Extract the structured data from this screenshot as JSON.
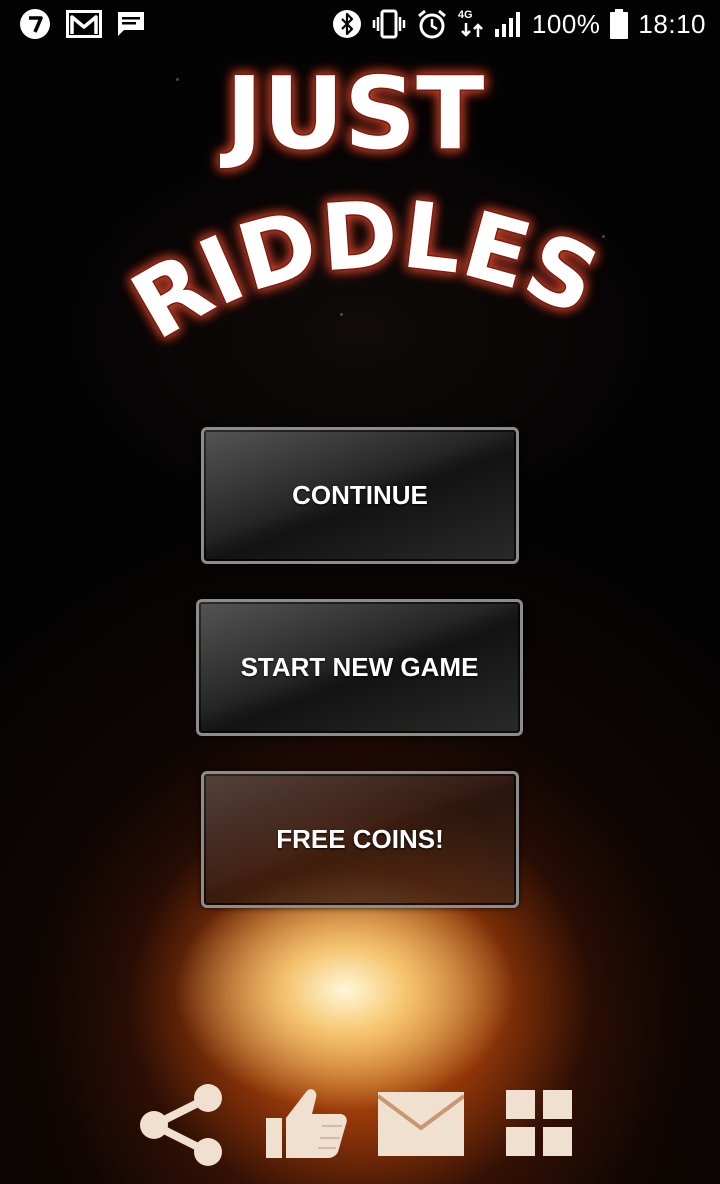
{
  "status_bar": {
    "battery_percent": "100%",
    "time": "18:10",
    "network_label": "4G",
    "left_icons": [
      "app-notification-icon",
      "gmail-icon",
      "message-icon"
    ],
    "right_icons": [
      "bluetooth-icon",
      "vibrate-icon",
      "alarm-icon",
      "signal-icon",
      "battery-icon"
    ]
  },
  "title": {
    "line1": "JUST",
    "line2": "RIDDLES"
  },
  "menu": {
    "continue_label": "CONTINUE",
    "start_new_game_label": "START NEW GAME",
    "free_coins_label": "FREE COINS!"
  },
  "bottom_actions": [
    "share-icon",
    "thumbs-up-icon",
    "mail-icon",
    "more-apps-grid-icon"
  ],
  "colors": {
    "title_fill": "#ffffff",
    "title_outline": "#7a1a0c",
    "button_border": "#8c8c8c",
    "bottom_icon": "#f0e0d0"
  }
}
